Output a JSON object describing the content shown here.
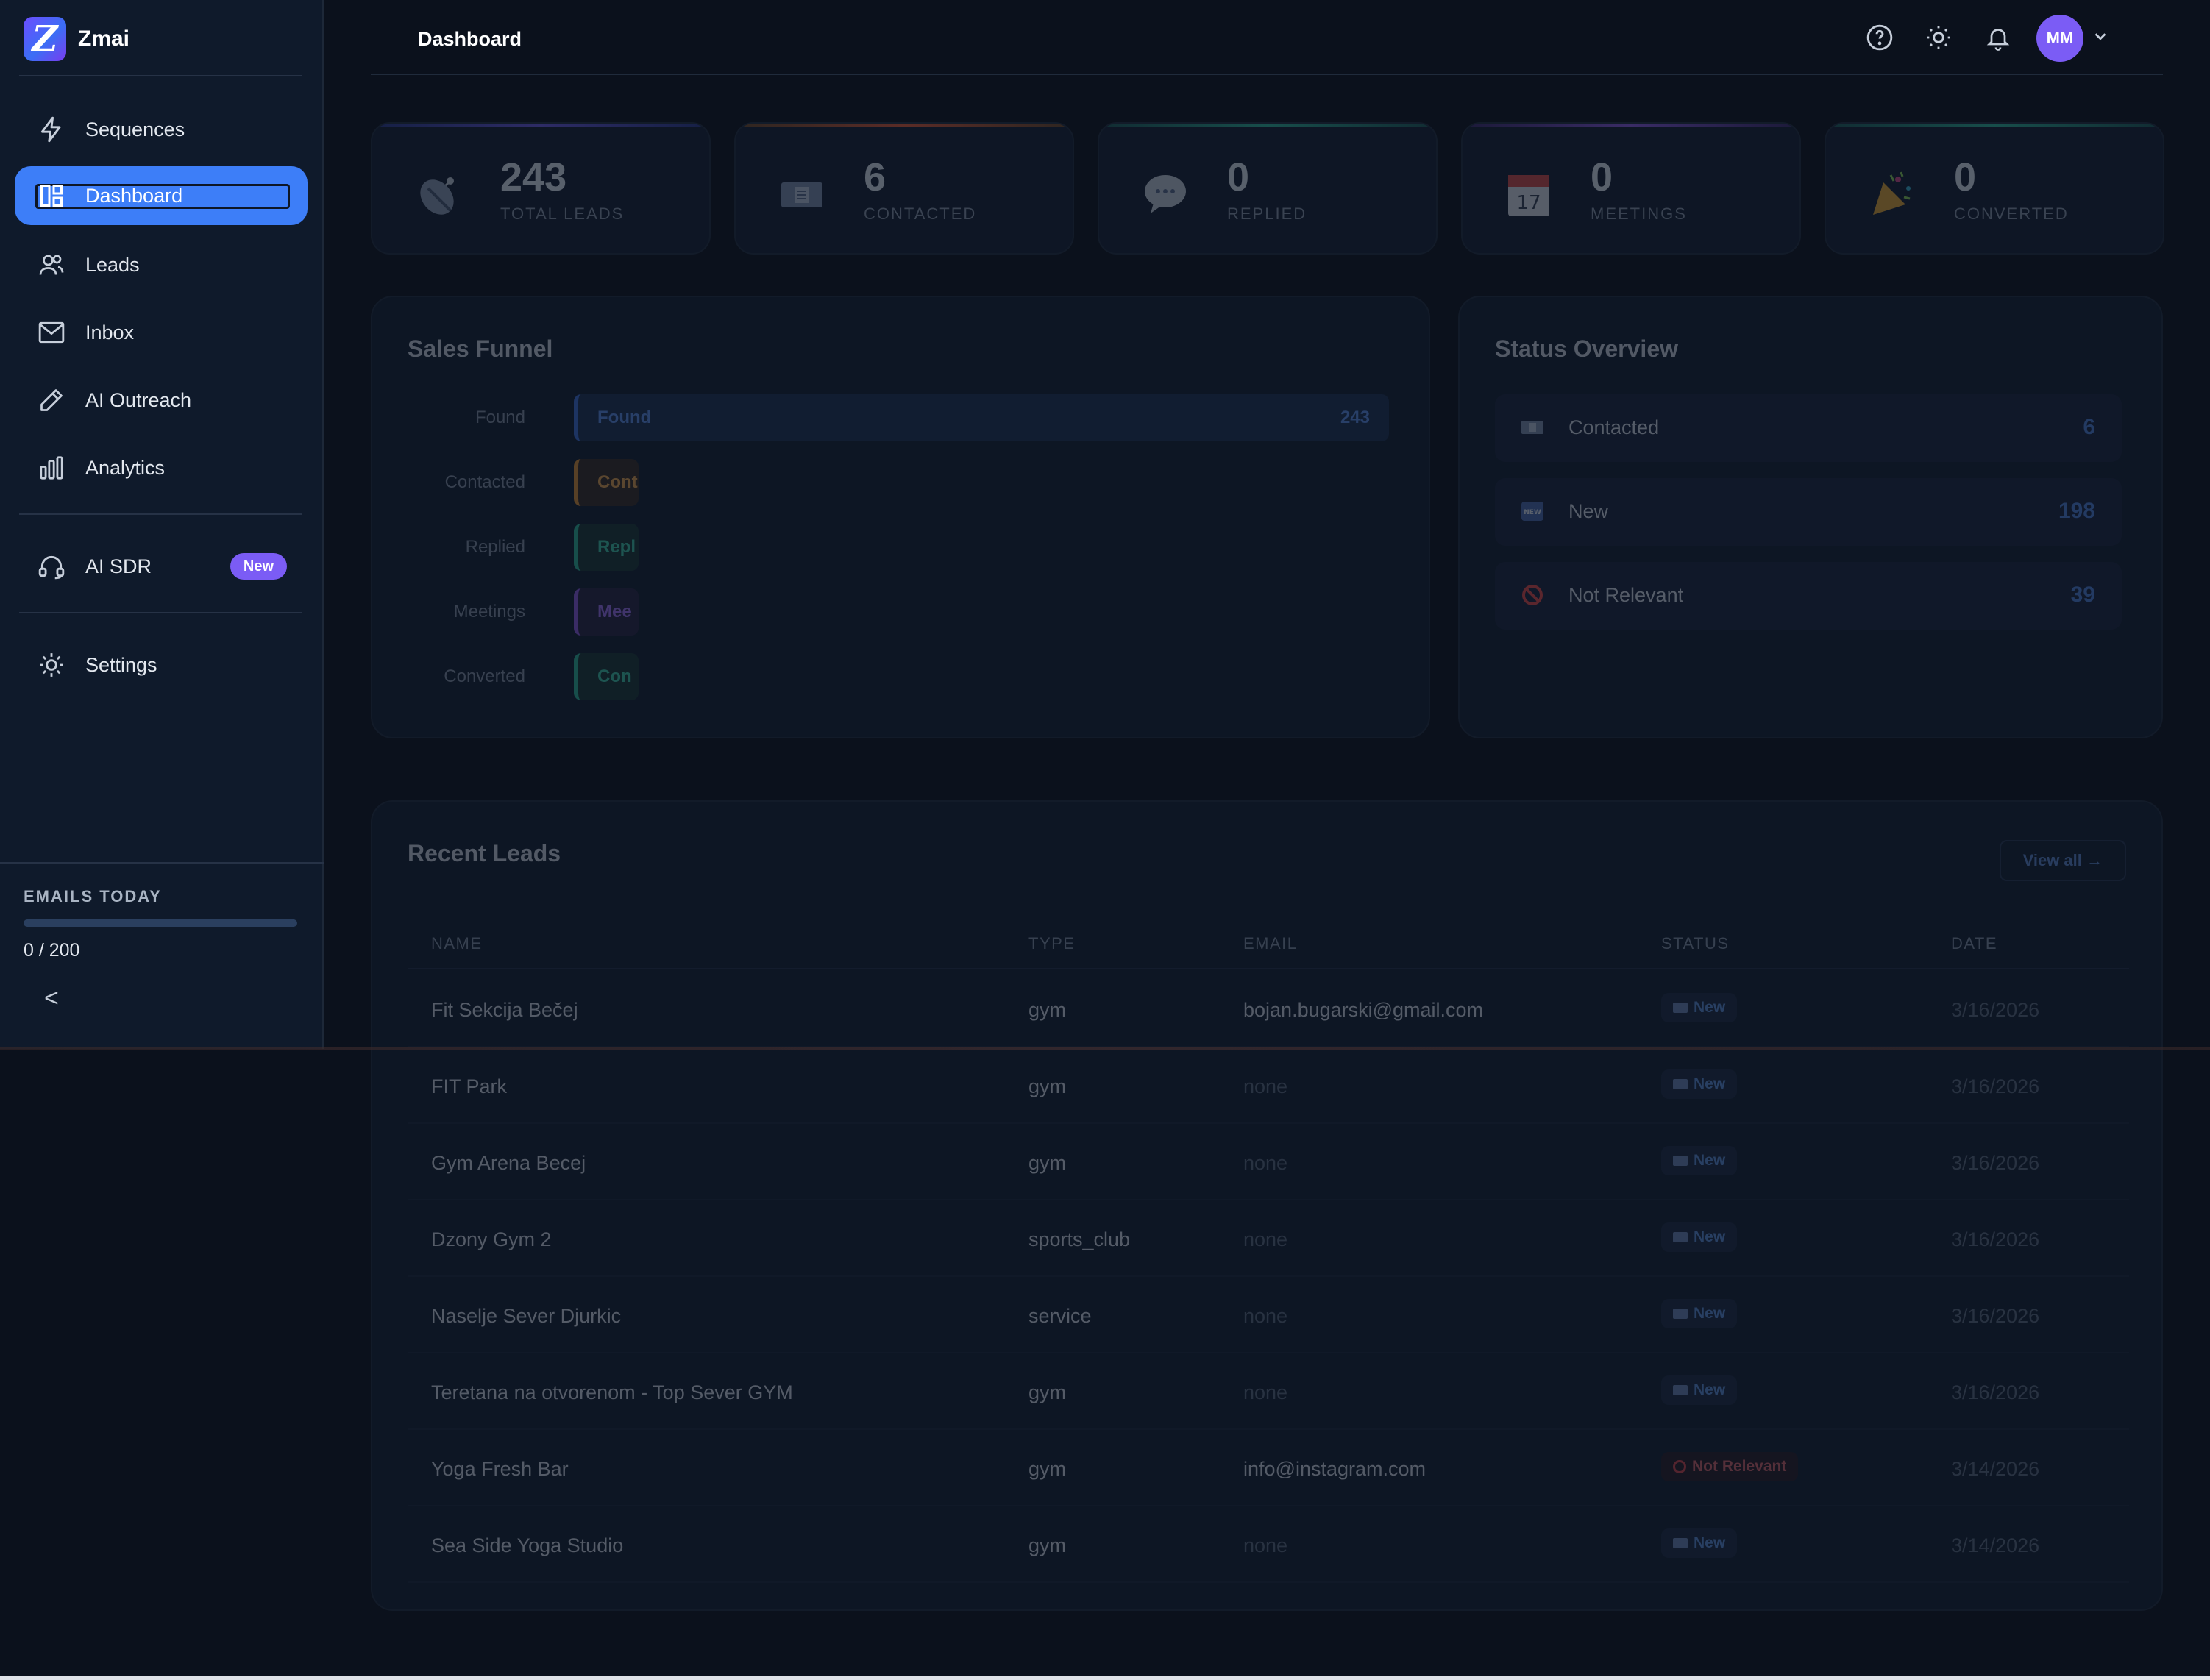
{
  "app": {
    "name": "Zmai",
    "logo_letter": "Z"
  },
  "sidebar": {
    "items": [
      {
        "label": "Sequences",
        "icon": "lightning-icon",
        "active": false
      },
      {
        "label": "Dashboard",
        "icon": "dashboard-icon",
        "active": true
      },
      {
        "label": "Leads",
        "icon": "users-icon",
        "active": false
      },
      {
        "label": "Inbox",
        "icon": "mail-icon",
        "active": false
      },
      {
        "label": "AI Outreach",
        "icon": "pen-icon",
        "active": false
      },
      {
        "label": "Analytics",
        "icon": "bar-chart-icon",
        "active": false
      },
      {
        "label": "AI SDR",
        "icon": "headset-icon",
        "active": false,
        "badge": "New"
      },
      {
        "label": "Settings",
        "icon": "gear-icon",
        "active": false
      }
    ],
    "emails_today": {
      "title": "EMAILS TODAY",
      "count": "0 / 200",
      "progress": 0
    },
    "collapse_label": "<"
  },
  "header": {
    "title": "Dashboard",
    "icons": [
      "help-icon",
      "sun-icon",
      "bell-icon"
    ],
    "avatar_initials": "MM"
  },
  "stats": [
    {
      "value": "243",
      "label": "TOTAL LEADS",
      "icon": "satellite-icon",
      "accent": "#4a6bd8"
    },
    {
      "value": "6",
      "label": "CONTACTED",
      "icon": "envelope-icon",
      "accent": "#d8913a"
    },
    {
      "value": "0",
      "label": "REPLIED",
      "icon": "speech-bubble-icon",
      "accent": "#2fb49a"
    },
    {
      "value": "0",
      "label": "MEETINGS",
      "icon": "calendar-icon",
      "accent": "#8a5ae0"
    },
    {
      "value": "0",
      "label": "CONVERTED",
      "icon": "party-popper-icon",
      "accent": "#2fb49a"
    }
  ],
  "sales_funnel": {
    "title": "Sales Funnel",
    "rows": [
      {
        "label": "Found",
        "bar_text": "Found",
        "value": "243",
        "color": "#3d6fd8"
      },
      {
        "label": "Contacted",
        "bar_text": "Cont",
        "value": "",
        "color": "#d8913a"
      },
      {
        "label": "Replied",
        "bar_text": "Repl",
        "value": "",
        "color": "#2fb49a"
      },
      {
        "label": "Meetings",
        "bar_text": "Mee",
        "value": "",
        "color": "#8a5ae0"
      },
      {
        "label": "Converted",
        "bar_text": "Con",
        "value": "",
        "color": "#2fb49a"
      }
    ]
  },
  "status_overview": {
    "title": "Status Overview",
    "rows": [
      {
        "label": "Contacted",
        "count": "6",
        "icon": "envelope-icon"
      },
      {
        "label": "New",
        "count": "198",
        "icon": "new-icon"
      },
      {
        "label": "Not Relevant",
        "count": "39",
        "icon": "prohibited-icon"
      }
    ]
  },
  "recent_leads": {
    "title": "Recent Leads",
    "view_all": "View all →",
    "columns": [
      "NAME",
      "TYPE",
      "EMAIL",
      "STATUS",
      "DATE"
    ],
    "rows": [
      {
        "name": "Fit Sekcija Bečej",
        "type": "gym",
        "email": "bojan.bugarski@gmail.com",
        "status": "New",
        "date": "3/16/2026"
      },
      {
        "name": "FIT Park",
        "type": "gym",
        "email": "none",
        "status": "New",
        "date": "3/16/2026"
      },
      {
        "name": "Gym Arena Becej",
        "type": "gym",
        "email": "none",
        "status": "New",
        "date": "3/16/2026"
      },
      {
        "name": "Dzony Gym 2",
        "type": "sports_club",
        "email": "none",
        "status": "New",
        "date": "3/16/2026"
      },
      {
        "name": "Naselje Sever Djurkic",
        "type": "service",
        "email": "none",
        "status": "New",
        "date": "3/16/2026"
      },
      {
        "name": "Teretana na otvorenom - Top Sever GYM",
        "type": "gym",
        "email": "none",
        "status": "New",
        "date": "3/16/2026"
      },
      {
        "name": "Yoga Fresh Bar",
        "type": "gym",
        "email": "info@instagram.com",
        "status": "Not Relevant",
        "date": "3/14/2026"
      },
      {
        "name": "Sea Side Yoga Studio",
        "type": "gym",
        "email": "none",
        "status": "New",
        "date": "3/14/2026"
      }
    ]
  }
}
